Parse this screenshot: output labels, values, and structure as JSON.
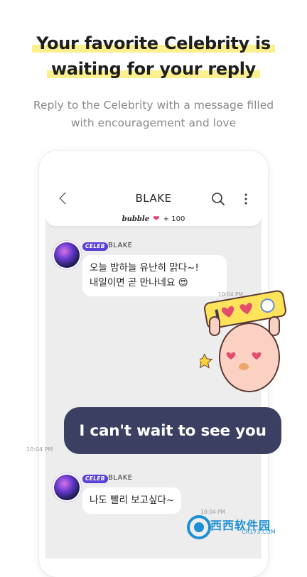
{
  "headline": {
    "line1": "Your favorite Celebrity is",
    "line2": "waiting for your reply",
    "highlight_color": "#fcef8e"
  },
  "subtitle": {
    "line1": "Reply to the Celebrity with a message filled",
    "line2": "with encouragement and love"
  },
  "chat": {
    "title": "BLAKE",
    "bubble_label": "bubble",
    "bubble_count": "+ 100",
    "messages": [
      {
        "badge": "CELEB",
        "sender": "BLAKE",
        "line1": "오늘 밤하늘 유난히 맑다~!",
        "line2": "내일이면 곧 만나네요 😍",
        "time": "10:04 PM"
      },
      {
        "text": "I can't wait to see you",
        "time": "10:04 PM"
      },
      {
        "badge": "CELEB",
        "sender": "BLAKE",
        "line1": "나도 빨리 보고싶다~",
        "time": "10:04 PM"
      }
    ],
    "sticker_sign": "I ♥ ♥"
  },
  "watermark": {
    "brand": "西西软件园",
    "url": "CR173.COM"
  },
  "colors": {
    "accent": "#5b3fd6",
    "reply_bubble": "#3b3f61",
    "chat_bg": "#ededed",
    "heart": "#e83f6f"
  }
}
